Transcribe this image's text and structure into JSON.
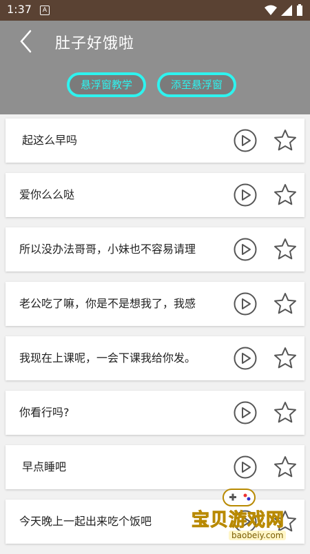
{
  "status_bar": {
    "time": "1:37",
    "notification_letter": "A"
  },
  "header": {
    "title": "肚子好饿啦",
    "buttons": [
      {
        "label": "悬浮窗教学"
      },
      {
        "label": "添至悬浮窗"
      }
    ]
  },
  "phrases": [
    "起这么早吗",
    "爱你么么哒",
    "所以没办法哥哥，小妹也不容易请理",
    "老公吃了嘛，你是不是想我了，我感",
    "我现在上课呢，一会下课我给你发。",
    "你看行吗?",
    "早点睡吧",
    "今天晚上一起出来吃个饭吧"
  ],
  "watermark": {
    "text": "宝贝游戏网",
    "url": "baobeiy.com"
  },
  "colors": {
    "status_bar": "#5a4233",
    "header": "#8f8f8f",
    "accent": "#2ef3ef"
  }
}
